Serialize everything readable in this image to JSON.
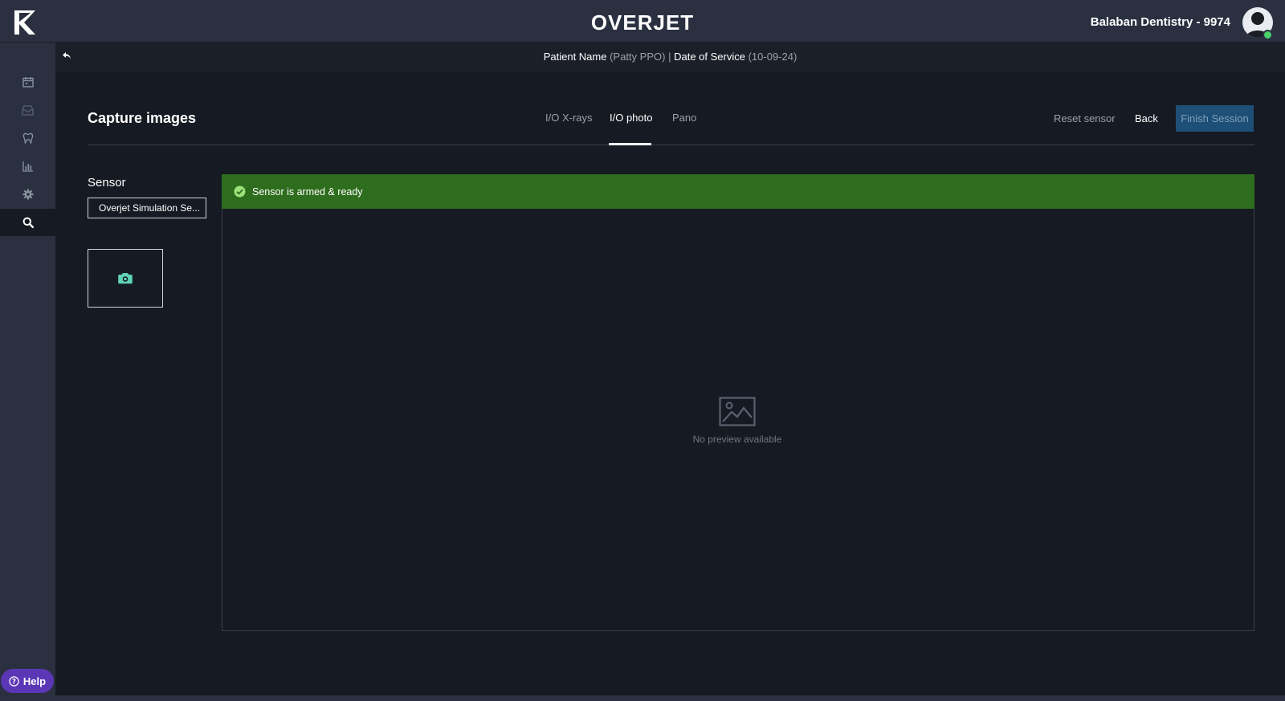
{
  "app": {
    "brand": "OVERJET",
    "practice_name": "Balaban Dentistry - 9974",
    "logo_icon": "overjet-logo-icon",
    "avatar_icon": "user-avatar-icon"
  },
  "sidebar": {
    "items": [
      {
        "name": "calendar",
        "icon": "calendar-icon",
        "active": false
      },
      {
        "name": "inbox",
        "icon": "inbox-icon",
        "active": false
      },
      {
        "name": "tooth",
        "icon": "tooth-icon",
        "active": false
      },
      {
        "name": "analytics",
        "icon": "bar-chart-icon",
        "active": false
      },
      {
        "name": "settings",
        "icon": "gear-icon",
        "active": false
      },
      {
        "name": "search",
        "icon": "search-icon",
        "active": true
      }
    ],
    "help_label": "Help"
  },
  "subheader": {
    "patient_label": "Patient Name",
    "patient_value": "(Patty PPO)",
    "separator": "|",
    "date_label": "Date of Service",
    "date_value": "(10-09-24)"
  },
  "capture": {
    "title": "Capture images",
    "tabs": [
      {
        "label": "I/O X-rays",
        "active": false
      },
      {
        "label": "I/O photo",
        "active": true
      },
      {
        "label": "Pano",
        "active": false
      }
    ],
    "reset_label": "Reset sensor",
    "back_label": "Back",
    "finish_label": "Finish Session",
    "sensor_label": "Sensor",
    "sensor_value": "Overjet Simulation Se...",
    "status_text": "Sensor is armed & ready",
    "no_preview_text": "No preview available"
  },
  "colors": {
    "accent_green": "#2e6d1d",
    "finish_button": "#1e4f77",
    "help_button": "#5b37b6",
    "camera_icon": "#5fd3b4"
  }
}
